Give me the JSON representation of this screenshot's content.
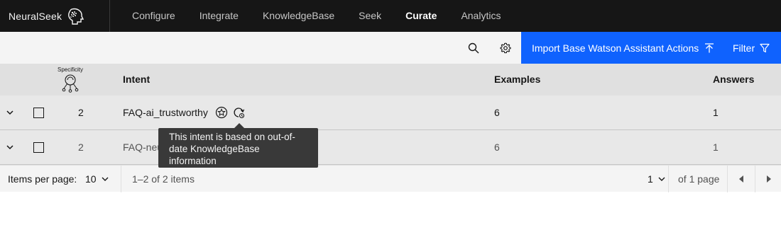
{
  "brand": {
    "name": "NeuralSeek",
    "logo_icon": "brain-head-icon"
  },
  "nav": {
    "items": [
      {
        "label": "Configure",
        "active": false
      },
      {
        "label": "Integrate",
        "active": false
      },
      {
        "label": "KnowledgeBase",
        "active": false
      },
      {
        "label": "Seek",
        "active": false
      },
      {
        "label": "Curate",
        "active": true
      },
      {
        "label": "Analytics",
        "active": false
      }
    ]
  },
  "toolbar": {
    "search_icon": "search-icon",
    "settings_icon": "gear-icon",
    "import_label": "Import Base Watson Assistant Actions",
    "import_icon": "upload-icon",
    "filter_label": "Filter",
    "filter_icon": "filter-icon",
    "accent_color": "#0f62fe"
  },
  "table": {
    "headers": {
      "specificity": "Specificity",
      "intent": "Intent",
      "examples": "Examples",
      "answers": "Answers"
    },
    "rows": [
      {
        "specificity": "2",
        "intent": "FAQ-ai_trustworthy",
        "examples": "6",
        "answers": "1"
      },
      {
        "specificity": "2",
        "intent": "FAQ-neu",
        "examples": "6",
        "answers": "1"
      }
    ]
  },
  "tooltip": {
    "text_line1": "This intent is based on out-of-",
    "text_line2": "date KnowledgeBase",
    "text_line3": "information"
  },
  "pagination": {
    "items_per_page_label": "Items per page:",
    "items_per_page_value": "10",
    "range_text": "1–2 of 2 items",
    "page_value": "1",
    "of_pages_text": "of 1 page"
  }
}
